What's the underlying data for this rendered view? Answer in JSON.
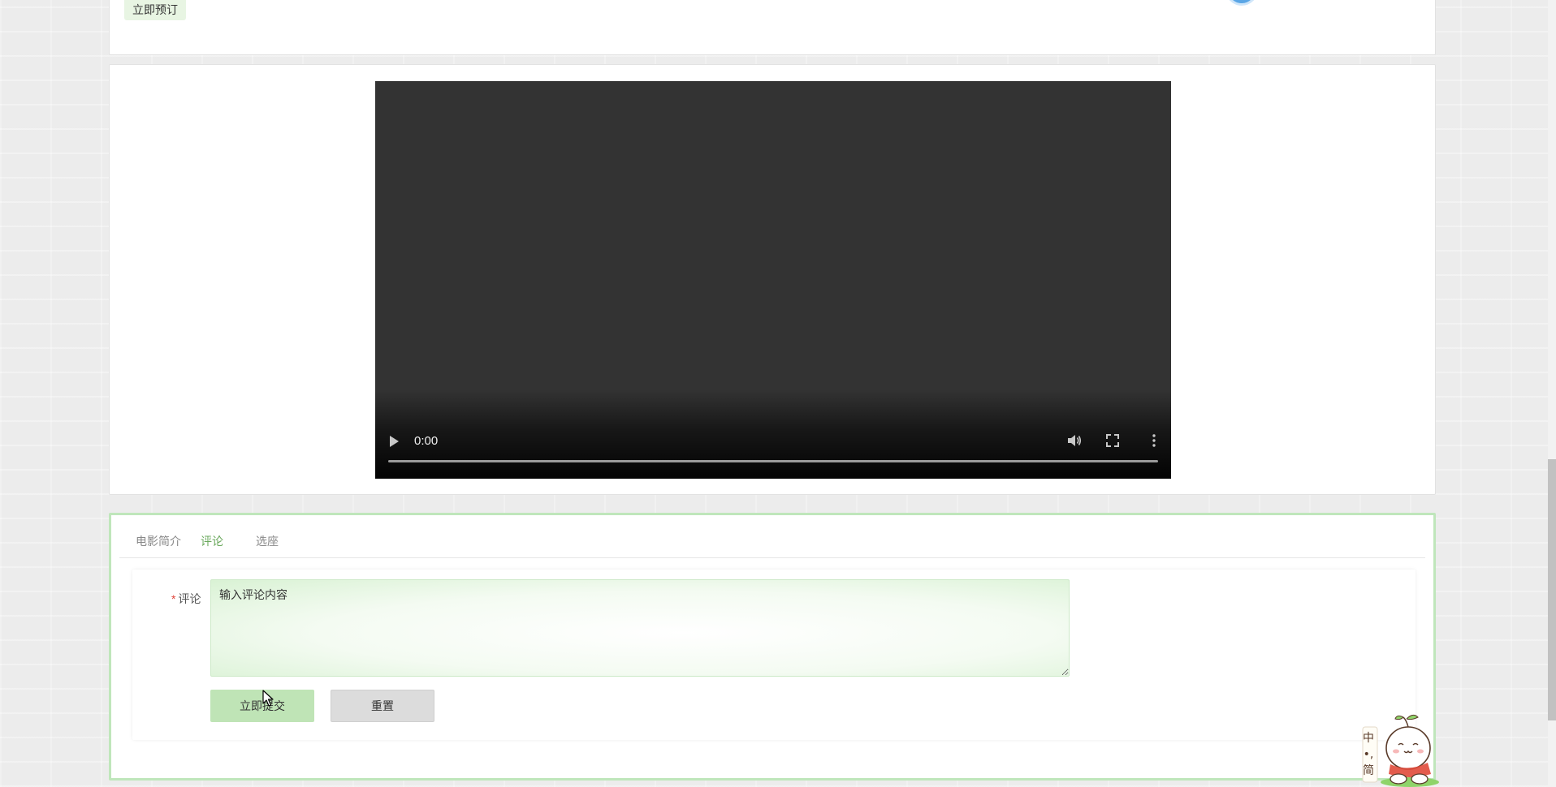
{
  "top_panel": {
    "reserve_label": "立即预订"
  },
  "video": {
    "current_time": "0:00",
    "progress": 0
  },
  "tabs": [
    {
      "label": "电影简介",
      "active": false
    },
    {
      "label": "评论",
      "active": true
    },
    {
      "label": "选座",
      "active": false
    }
  ],
  "comment_form": {
    "label": "评论",
    "required_mark": "*",
    "placeholder": "输入评论内容",
    "submit_label": "立即提交",
    "reset_label": "重置"
  },
  "mascot": {
    "text_top": "中",
    "text_mid": "•,",
    "text_bottom": "简"
  },
  "colors": {
    "accent_green": "#6aa85c",
    "submit_bg": "#bfe4b6",
    "panel_border_green": "#bfe6bb",
    "required_red": "#e0443a",
    "video_bg": "#333333"
  },
  "icons": [
    "play-icon",
    "volume-icon",
    "fullscreen-icon",
    "more-options-icon",
    "mouse-cursor-icon",
    "mascot-icon"
  ]
}
